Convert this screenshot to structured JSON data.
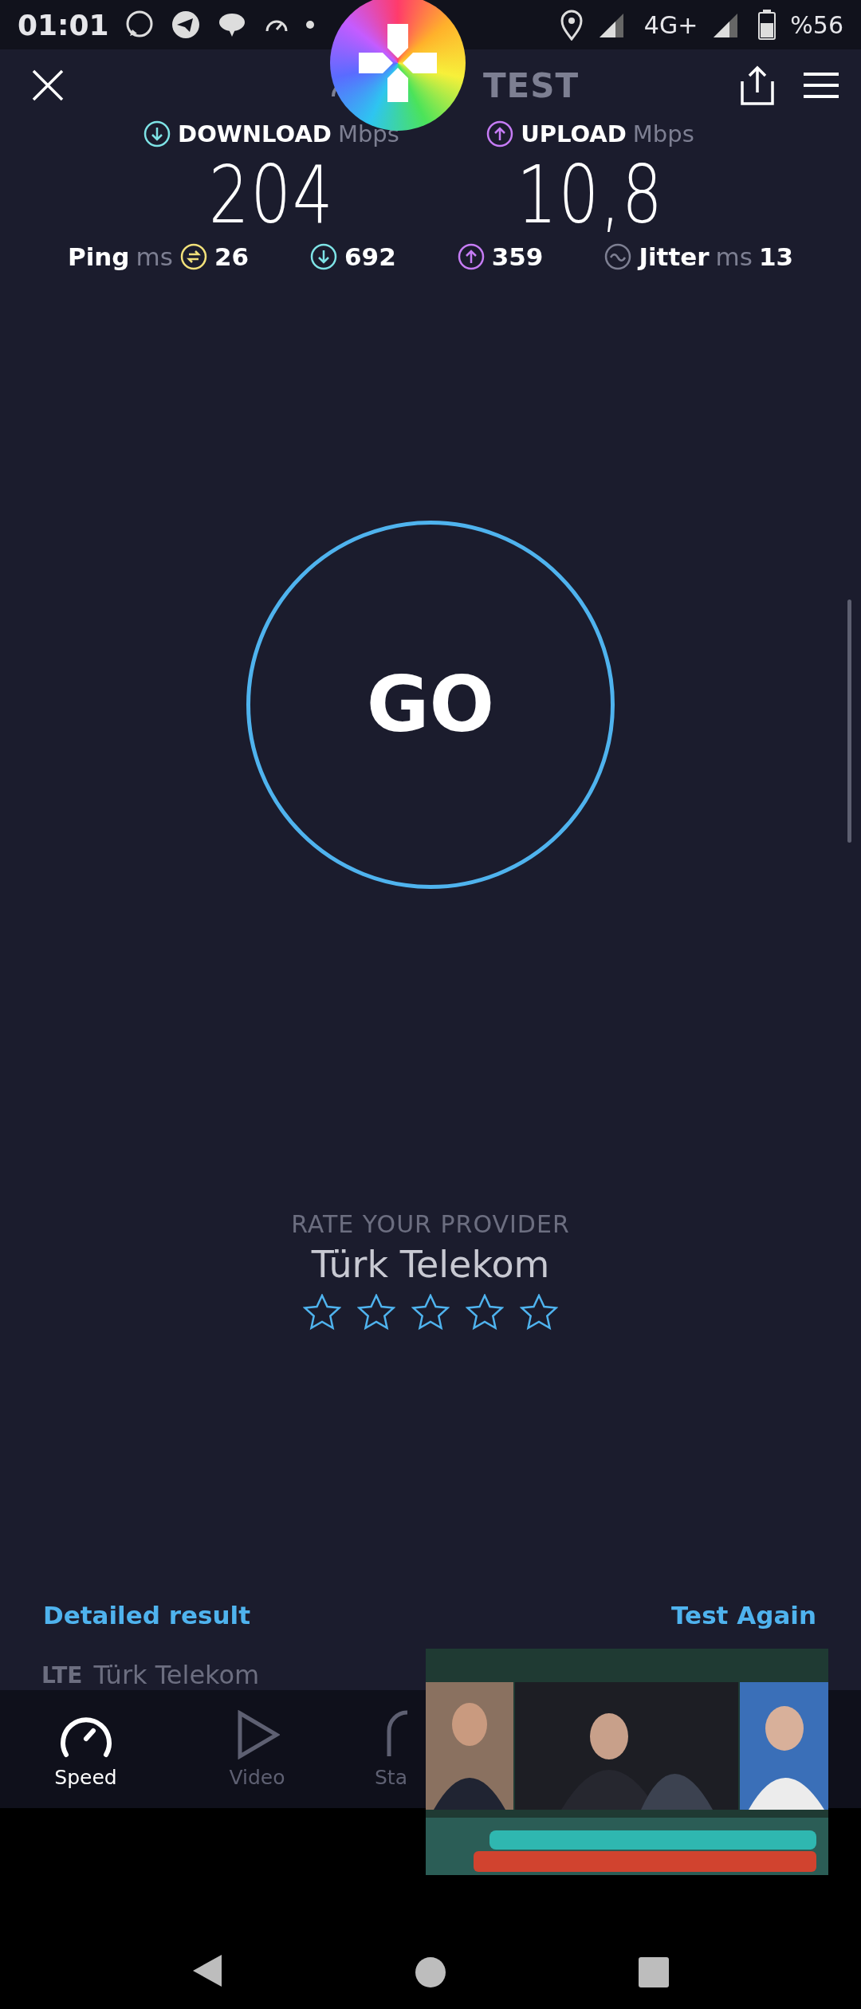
{
  "status_bar": {
    "time": "01:01",
    "network": "4G+",
    "battery": "%56"
  },
  "header": {
    "title": "TEST"
  },
  "results": [
    {
      "kind": "download",
      "label": "DOWNLOAD",
      "unit": "Mbps",
      "value": "204"
    },
    {
      "kind": "upload",
      "label": "UPLOAD",
      "unit": "Mbps",
      "value": "10,8"
    }
  ],
  "metrics": {
    "ping": {
      "label": "Ping",
      "unit": "ms",
      "value": "26"
    },
    "download_latency": "692",
    "upload_latency": "359",
    "jitter": {
      "label": "Jitter",
      "unit": "ms",
      "value": "13"
    }
  },
  "go_button": "GO",
  "rating": {
    "prompt": "RATE YOUR PROVIDER",
    "provider": "Türk Telekom",
    "stars": 0
  },
  "links": {
    "detailed": "Detailed result",
    "again": "Test Again"
  },
  "connection": {
    "type": "LTE",
    "provider": "Türk Telekom"
  },
  "tabs": [
    {
      "kind": "speed",
      "label": "Speed",
      "selected": true
    },
    {
      "kind": "video",
      "label": "Video",
      "selected": false
    },
    {
      "kind": "stats",
      "label": "Sta",
      "selected": false
    }
  ]
}
